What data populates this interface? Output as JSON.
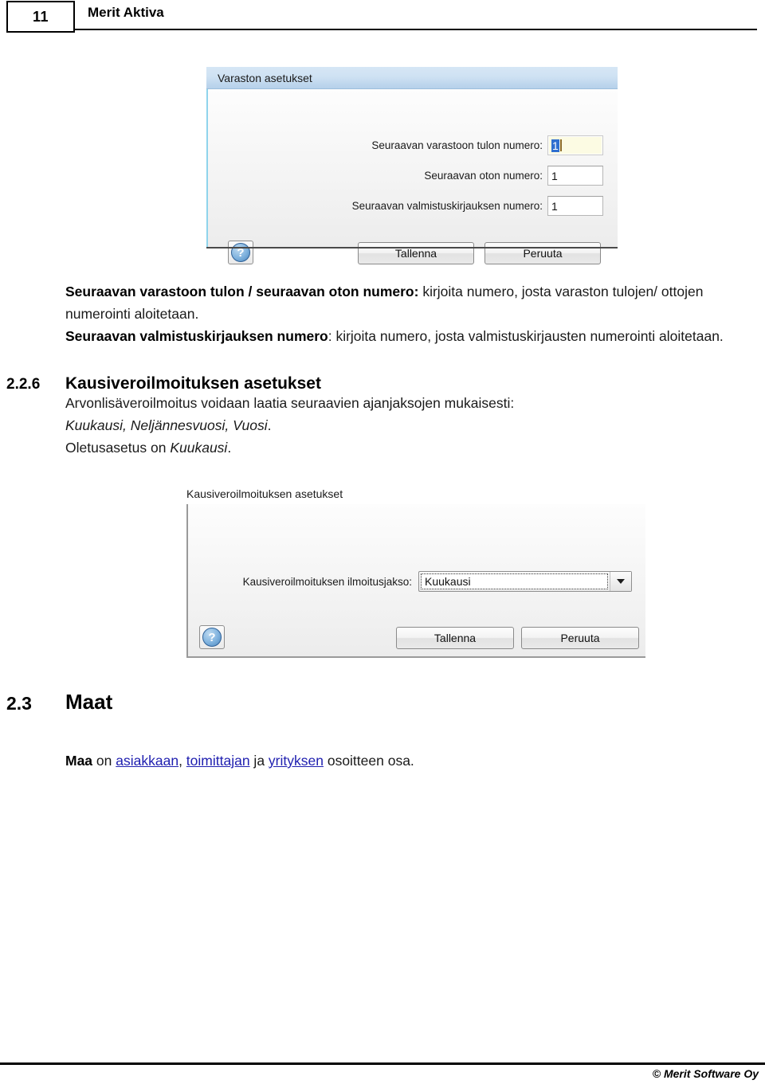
{
  "page": {
    "number": "11",
    "header_title": "Merit Aktiva",
    "footer": "© Merit Software Oy"
  },
  "paragraph_1": {
    "bold_lead": "Seuraavan varastoon tulon / seuraavan oton numero:",
    "rest": " kirjoita numero, josta varaston tulojen/ ottojen numerointi aloitetaan.",
    "bold_lead_2": "Seuraavan valmistuskirjauksen numero",
    "rest_2": ": kirjoita numero, josta valmistuskirjausten numerointi aloitetaan."
  },
  "section_226": {
    "number": "2.2.6",
    "title": "Kausiveroilmoituksen asetukset",
    "body_part_1": "Arvonlisäveroilmoitus voidaan laatia seuraavien ajanjaksojen mukaisesti: ",
    "body_italic_1": "Kuukausi, Neljännesvuosi, Vuosi",
    "body_part_2": ".",
    "body_part_3": "Oletusasetus on ",
    "body_italic_2": "Kuukausi",
    "body_part_4": "."
  },
  "section_23": {
    "number": "2.3",
    "title": "Maat",
    "bold_lead": "Maa",
    "text_1": " on ",
    "link_1": "asiakkaan",
    "text_2": ", ",
    "link_2": "toimittajan",
    "text_3": " ja ",
    "link_3": "yrityksen",
    "text_4": " osoitteen osa."
  },
  "dialog_varasto": {
    "title": "Varaston asetukset",
    "rows": [
      {
        "label": "Seuraavan varastoon tulon numero:",
        "value": "1"
      },
      {
        "label": "Seuraavan oton numero:",
        "value": "1"
      },
      {
        "label": "Seuraavan valmistuskirjauksen numero:",
        "value": "1"
      }
    ],
    "help_glyph": "?",
    "save_label": "Tallenna",
    "cancel_label": "Peruuta"
  },
  "dialog_kausivero": {
    "title": "Kausiveroilmoituksen asetukset",
    "field_label": "Kausiveroilmoituksen ilmoitusjakso:",
    "field_value": "Kuukausi",
    "options": [
      "Kuukausi",
      "Neljännesvuosi",
      "Vuosi"
    ],
    "help_glyph": "?",
    "save_label": "Tallenna",
    "cancel_label": "Peruuta"
  },
  "colors": {
    "title_bar_blue": "#cfe2f3",
    "focus_field": "#fcfbe3",
    "selection_blue": "#2f6fd0",
    "link_blue": "#2020b0"
  }
}
